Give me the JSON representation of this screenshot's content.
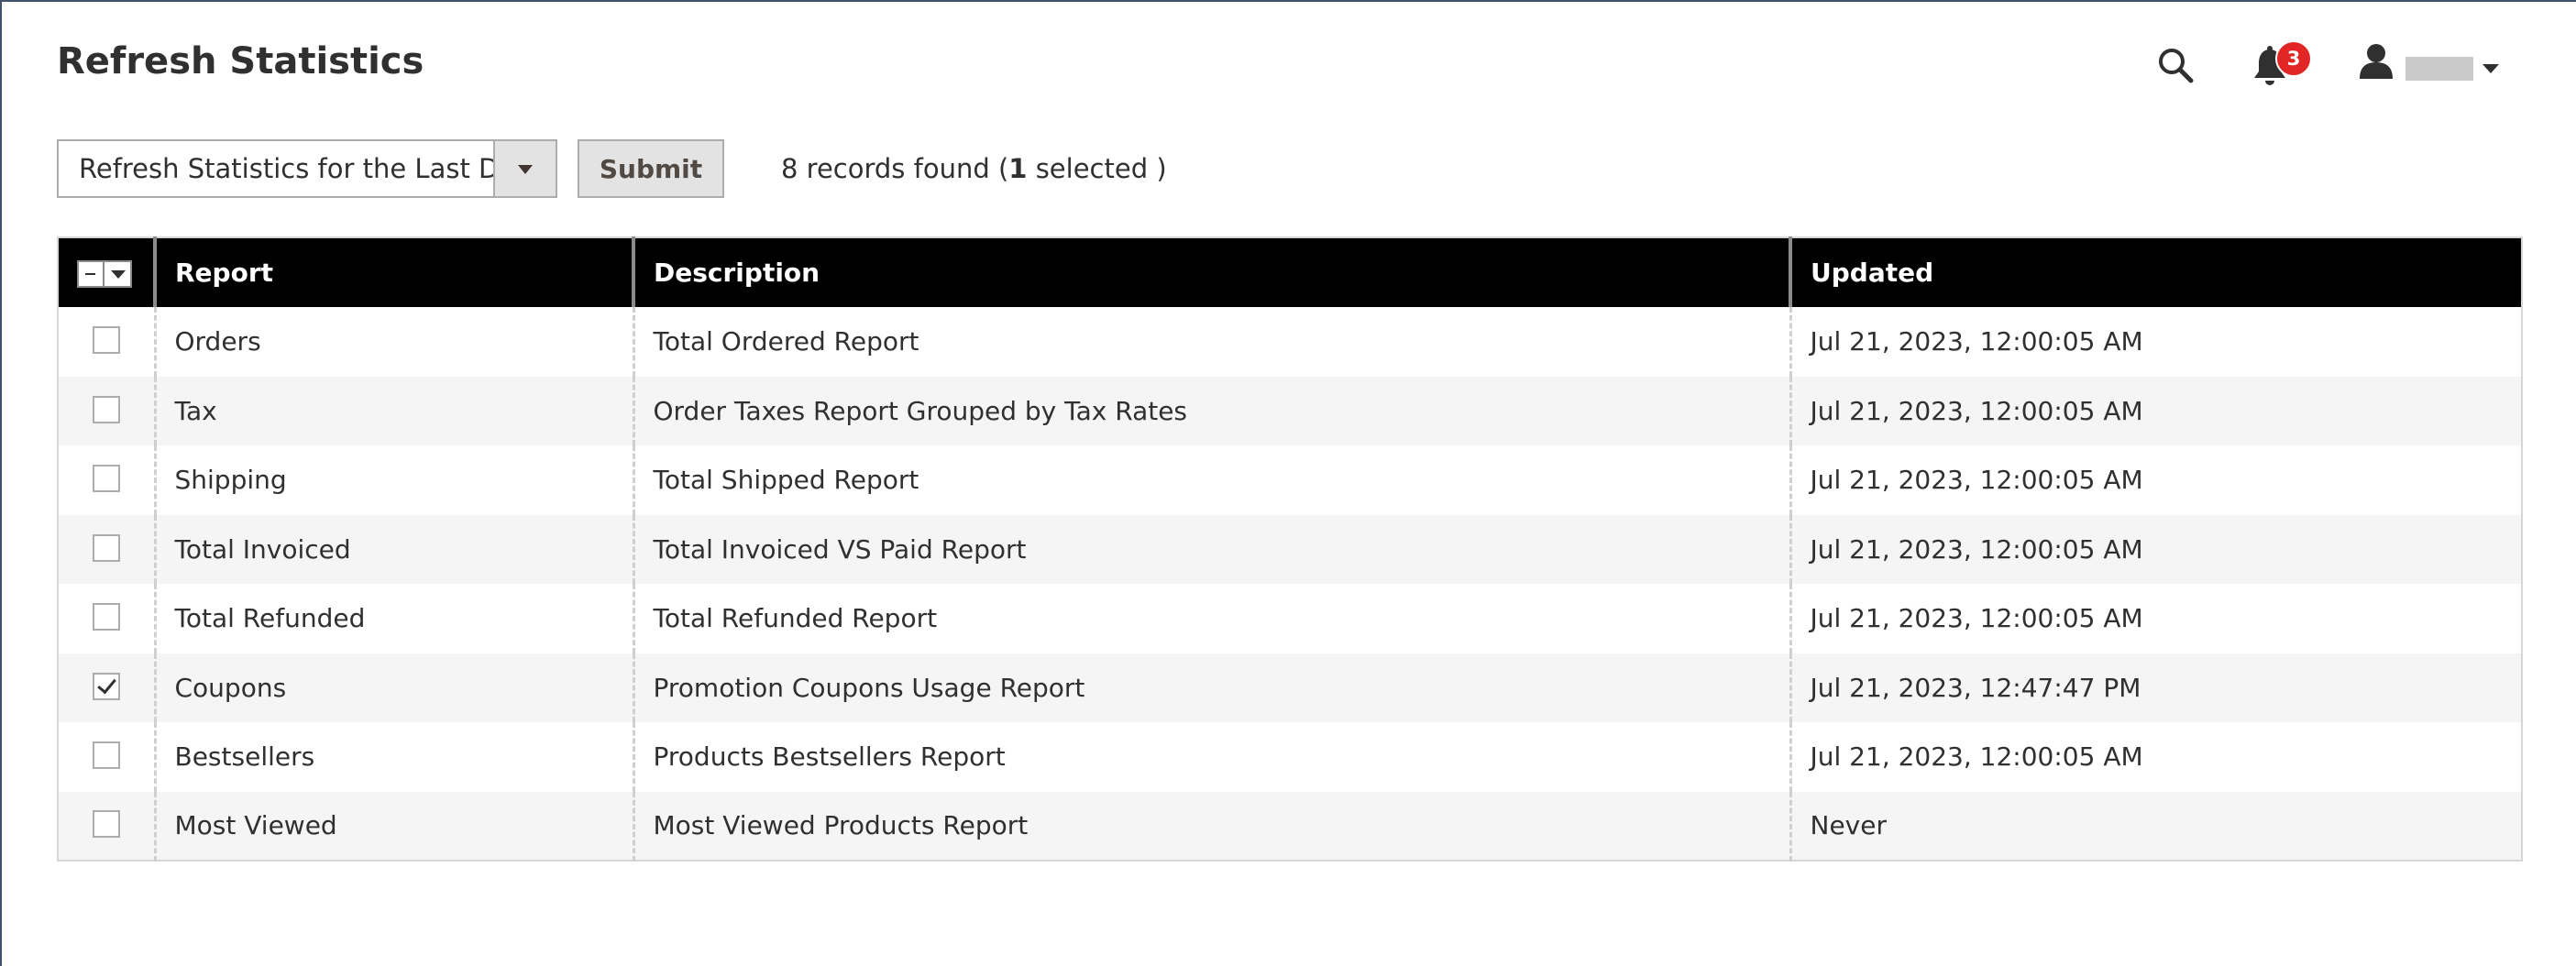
{
  "page": {
    "title": "Refresh Statistics"
  },
  "header": {
    "notification_count": "3",
    "icons": [
      "search-icon",
      "bell-icon",
      "user-icon"
    ]
  },
  "toolbar": {
    "action_select_value": "Refresh Statistics for the Last Day",
    "submit_label": "Submit",
    "records_count_text": "8 records found (",
    "selected_count": "1",
    "selected_suffix": " selected )"
  },
  "grid": {
    "columns": [
      "Report",
      "Description",
      "Updated"
    ],
    "rows": [
      {
        "checked": false,
        "report": "Orders",
        "description": "Total Ordered Report",
        "updated": "Jul 21, 2023, 12:00:05 AM"
      },
      {
        "checked": false,
        "report": "Tax",
        "description": "Order Taxes Report Grouped by Tax Rates",
        "updated": "Jul 21, 2023, 12:00:05 AM"
      },
      {
        "checked": false,
        "report": "Shipping",
        "description": "Total Shipped Report",
        "updated": "Jul 21, 2023, 12:00:05 AM"
      },
      {
        "checked": false,
        "report": "Total Invoiced",
        "description": "Total Invoiced VS Paid Report",
        "updated": "Jul 21, 2023, 12:00:05 AM"
      },
      {
        "checked": false,
        "report": "Total Refunded",
        "description": "Total Refunded Report",
        "updated": "Jul 21, 2023, 12:00:05 AM"
      },
      {
        "checked": true,
        "report": "Coupons",
        "description": "Promotion Coupons Usage Report",
        "updated": "Jul 21, 2023, 12:47:47 PM"
      },
      {
        "checked": false,
        "report": "Bestsellers",
        "description": "Products Bestsellers Report",
        "updated": "Jul 21, 2023, 12:00:05 AM"
      },
      {
        "checked": false,
        "report": "Most Viewed",
        "description": "Most Viewed Products Report",
        "updated": "Never"
      }
    ]
  },
  "colors": {
    "header_bg": "#000000",
    "badge": "#e22626",
    "button_bg": "#e3e3e3",
    "row_alt": "#f5f5f5"
  }
}
